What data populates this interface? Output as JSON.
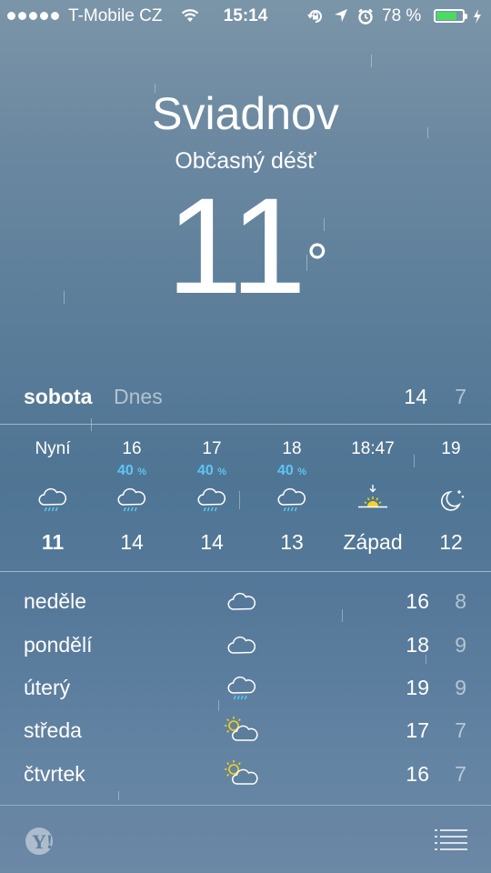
{
  "status_bar": {
    "carrier": "T-Mobile CZ",
    "time": "15:14",
    "battery_percent": "78 %",
    "battery_level": 0.78,
    "icons": [
      "signal-dots-icon",
      "wifi-icon",
      "rotation-lock-icon",
      "location-arrow-icon",
      "alarm-clock-icon",
      "battery-icon",
      "charging-bolt-icon"
    ]
  },
  "location": {
    "city": "Sviadnov",
    "condition": "Občasný déšť",
    "temperature": "11",
    "degree_symbol": "°"
  },
  "today": {
    "day": "sobota",
    "label": "Dnes",
    "high": "14",
    "low": "7"
  },
  "hourly": [
    {
      "time": "Nyní",
      "chance": "",
      "icon": "rain-cloud-icon",
      "temp": "11",
      "bold": true
    },
    {
      "time": "16",
      "chance": "40",
      "chance_unit": "%",
      "icon": "rain-cloud-icon",
      "temp": "14"
    },
    {
      "time": "17",
      "chance": "40",
      "chance_unit": "%",
      "icon": "rain-cloud-icon",
      "temp": "14"
    },
    {
      "time": "18",
      "chance": "40",
      "chance_unit": "%",
      "icon": "rain-cloud-icon",
      "temp": "13"
    },
    {
      "time": "18:47",
      "chance": "",
      "icon": "sunset-icon",
      "temp": "Západ"
    },
    {
      "time": "19",
      "chance": "",
      "icon": "moon-stars-icon",
      "temp": "12"
    }
  ],
  "daily": [
    {
      "day": "neděle",
      "icon": "cloud-icon",
      "high": "16",
      "low": "8"
    },
    {
      "day": "pondělí",
      "icon": "cloud-icon",
      "high": "18",
      "low": "9"
    },
    {
      "day": "úterý",
      "icon": "rain-cloud-icon",
      "high": "19",
      "low": "9"
    },
    {
      "day": "středa",
      "icon": "partly-sunny-icon",
      "high": "17",
      "low": "7"
    },
    {
      "day": "čtvrtek",
      "icon": "partly-sunny-icon",
      "high": "16",
      "low": "7"
    }
  ],
  "footer": {
    "logo_text": "Y!",
    "icons": [
      "yahoo-logo-icon",
      "list-icon"
    ]
  },
  "colors": {
    "precip_blue": "#5bc6f5",
    "battery_green": "#4cd964",
    "sun_yellow": "#f7d21e"
  }
}
